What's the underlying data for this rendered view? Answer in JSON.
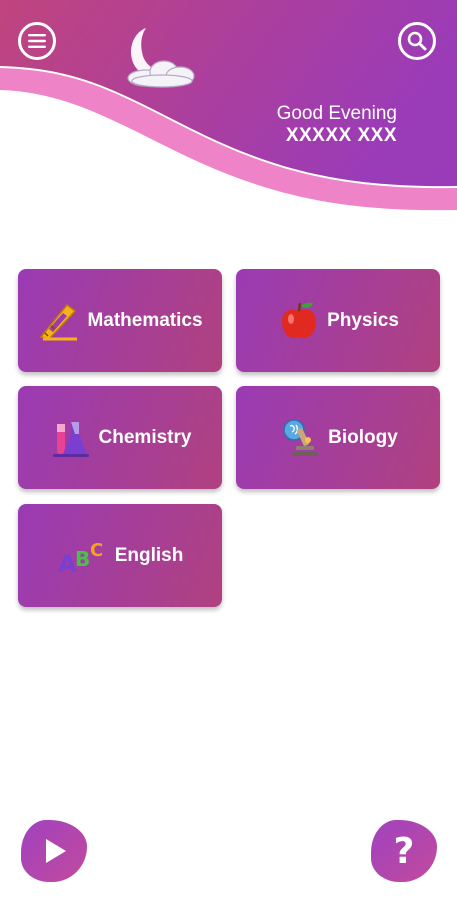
{
  "header": {
    "greeting": "Good Evening",
    "user_name": "XXXXX XXX",
    "menu_icon": "menu-icon",
    "search_icon": "search-icon",
    "decoration_icon": "moon-cloud-icon"
  },
  "subjects": [
    {
      "label": "Mathematics",
      "icon": "ruler-triangle-icon"
    },
    {
      "label": "Physics",
      "icon": "apple-icon"
    },
    {
      "label": "Chemistry",
      "icon": "flask-icon"
    },
    {
      "label": "Biology",
      "icon": "microscope-icon"
    },
    {
      "label": "English",
      "icon": "abc-letters-icon"
    }
  ],
  "footer": {
    "play_icon": "play-icon",
    "help_label": "?"
  },
  "colors": {
    "primary_purple": "#9a3bb4",
    "primary_magenta": "#b0417f",
    "wave_pink": "#ee7fc5",
    "background": "#ffffff"
  }
}
